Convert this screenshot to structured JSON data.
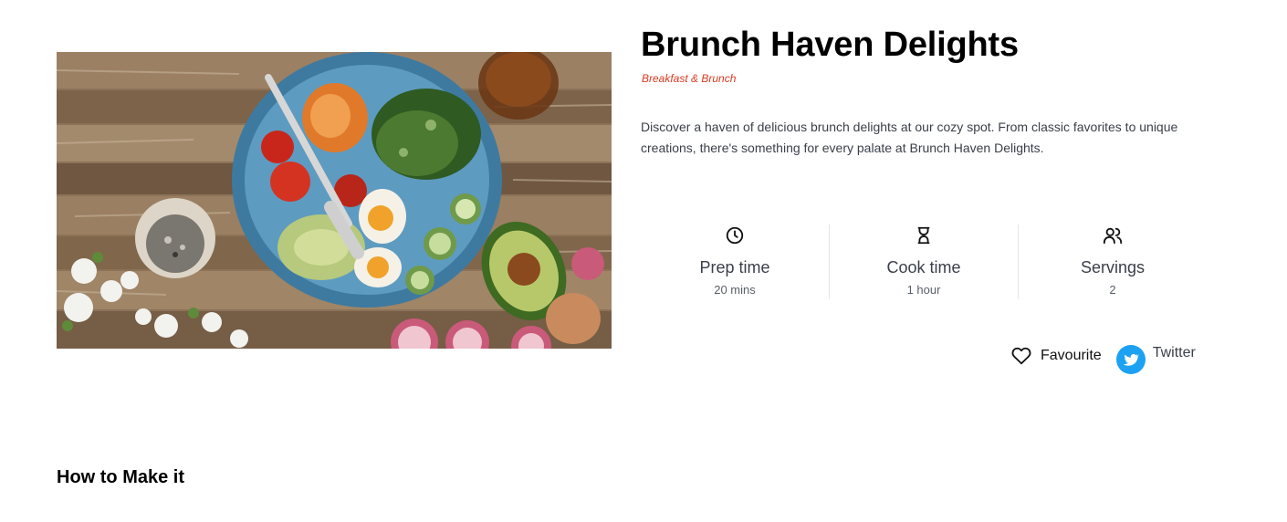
{
  "recipe": {
    "title": "Brunch Haven Delights",
    "category": "Breakfast & Brunch",
    "description": "Discover a haven of delicious brunch delights at our cozy spot. From classic favorites to unique creations, there's something for every palate at Brunch Haven Delights.",
    "image": {
      "subject": "blue plate with salad, tomatoes, boiled egg, radish, avocado on wooden table"
    }
  },
  "stats": [
    {
      "icon": "clock-icon",
      "label": "Prep time",
      "value": "20 mins"
    },
    {
      "icon": "hourglass-icon",
      "label": "Cook time",
      "value": "1 hour"
    },
    {
      "icon": "users-icon",
      "label": "Servings",
      "value": "2"
    }
  ],
  "actions": {
    "favourite_label": "Favourite",
    "twitter_label": "Twitter"
  },
  "sections": {
    "how_to_heading": "How to Make it"
  },
  "colors": {
    "accent": "#d93a1f",
    "twitter": "#1da1f2",
    "text_muted": "#3a3f4a"
  }
}
